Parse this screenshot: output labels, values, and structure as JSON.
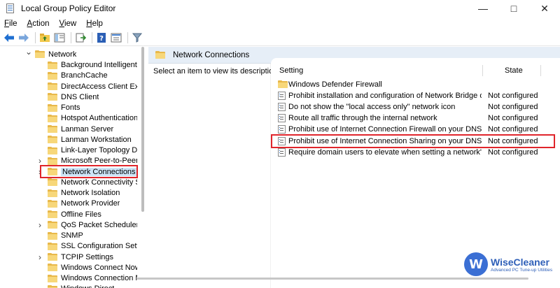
{
  "window": {
    "title": "Local Group Policy Editor",
    "controls": {
      "minimize": "—",
      "maximize": "□",
      "close": "✕"
    }
  },
  "menu": [
    {
      "label": "File",
      "accel": "F",
      "rest": "ile"
    },
    {
      "label": "Action",
      "accel": "A",
      "rest": "ction"
    },
    {
      "label": "View",
      "accel": "V",
      "rest": "iew"
    },
    {
      "label": "Help",
      "accel": "H",
      "rest": "elp"
    }
  ],
  "toolbar": {
    "buttons": [
      "back-icon",
      "forward-icon",
      "up-folder-icon",
      "show-hide-tree-icon",
      "export-list-icon",
      "help-icon",
      "properties-icon",
      "filter-icon"
    ]
  },
  "tree": {
    "parent": {
      "label": "Network",
      "expanded": true
    },
    "items": [
      {
        "label": "Background Intelligent Tr",
        "expandable": false
      },
      {
        "label": "BranchCache",
        "expandable": false
      },
      {
        "label": "DirectAccess Client Expe",
        "expandable": false
      },
      {
        "label": "DNS Client",
        "expandable": false
      },
      {
        "label": "Fonts",
        "expandable": false
      },
      {
        "label": "Hotspot Authentication",
        "expandable": false
      },
      {
        "label": "Lanman Server",
        "expandable": false
      },
      {
        "label": "Lanman Workstation",
        "expandable": false
      },
      {
        "label": "Link-Layer Topology Disc",
        "expandable": false
      },
      {
        "label": "Microsoft Peer-to-Peer N",
        "expandable": true
      },
      {
        "label": "Network Connections",
        "expandable": true,
        "selected": true
      },
      {
        "label": "Network Connectivity Sta",
        "expandable": false
      },
      {
        "label": "Network Isolation",
        "expandable": false
      },
      {
        "label": "Network Provider",
        "expandable": false
      },
      {
        "label": "Offline Files",
        "expandable": false
      },
      {
        "label": "QoS Packet Scheduler",
        "expandable": true
      },
      {
        "label": "SNMP",
        "expandable": false
      },
      {
        "label": "SSL Configuration Setting",
        "expandable": false
      },
      {
        "label": "TCPIP Settings",
        "expandable": true
      },
      {
        "label": "Windows Connect Now",
        "expandable": false
      },
      {
        "label": "Windows Connection Ma",
        "expandable": false
      },
      {
        "label": "Windows Direct",
        "expandable": false
      }
    ]
  },
  "right": {
    "header": "Network Connections",
    "description": "Select an item to view its description.",
    "columns": {
      "setting": "Setting",
      "state": "State"
    },
    "rows": [
      {
        "type": "folder",
        "name": "Windows Defender Firewall",
        "state": ""
      },
      {
        "type": "setting",
        "name": "Prohibit installation and configuration of Network Bridge on...",
        "state": "Not configured"
      },
      {
        "type": "setting",
        "name": "Do not show the \"local access only\" network icon",
        "state": "Not configured"
      },
      {
        "type": "setting",
        "name": "Route all traffic through the internal network",
        "state": "Not configured"
      },
      {
        "type": "setting",
        "name": "Prohibit use of Internet Connection Firewall on your DNS do...",
        "state": "Not configured"
      },
      {
        "type": "setting",
        "name": "Prohibit use of Internet Connection Sharing on your DNS do...",
        "state": "Not configured",
        "highlighted": true
      },
      {
        "type": "setting",
        "name": "Require domain users to elevate when setting a network's lo...",
        "state": "Not configured"
      }
    ]
  },
  "watermark": {
    "name": "WiseCleaner",
    "tagline": "Advanced PC Tune-up Utilities",
    "letter": "W"
  },
  "colors": {
    "highlight_red": "#e0252b",
    "selection_blue": "#cce4f7",
    "folder_yellow": "#f7d77a",
    "header_blue": "#e6eef7"
  }
}
